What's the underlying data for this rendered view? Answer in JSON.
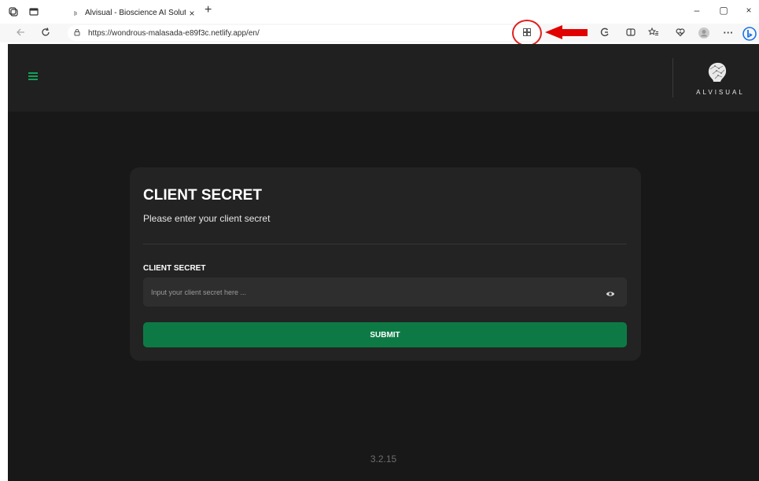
{
  "browser": {
    "tab_title": "Alvisual - Bioscience AI Solution",
    "tab_close": "×",
    "new_tab": "+",
    "url": "https://wondrous-malasada-e89f3c.netlify.app/en/",
    "window_controls": {
      "minimize": "–",
      "restore": "▢",
      "close": "×"
    },
    "more_label": "···"
  },
  "app": {
    "brand": "ALVISUAL",
    "card": {
      "title": "CLIENT SECRET",
      "subtitle": "Please enter your client secret",
      "field_label": "CLIENT SECRET",
      "field_placeholder": "Input your client secret here ...",
      "field_value": "",
      "submit_label": "SUBMIT"
    },
    "version": "3.2.15"
  },
  "colors": {
    "accent_green": "#0d7a45",
    "hamburger_green": "#14a05a",
    "annotation_red": "#e00000",
    "page_bg": "#181818",
    "header_bg": "#202020",
    "card_bg": "#232323"
  }
}
